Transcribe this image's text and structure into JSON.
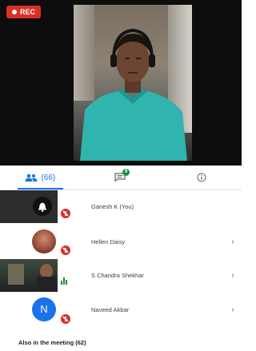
{
  "recording": {
    "label": "REC"
  },
  "tabs": [
    {
      "name": "people",
      "count": "(66)",
      "icon": "people-icon"
    },
    {
      "name": "chat",
      "badge": "9",
      "icon": "chat-icon"
    },
    {
      "name": "info",
      "icon": "info-icon"
    }
  ],
  "participants": [
    {
      "name": "Ganesh K (You)",
      "muted": true,
      "has_chevron": false,
      "avatar": "bell-tile"
    },
    {
      "name": "Hellen Daisy",
      "muted": true,
      "has_chevron": true,
      "avatar": "photo"
    },
    {
      "name": "S Chandra Shekhar",
      "muted": false,
      "speaking": true,
      "has_chevron": true,
      "avatar": "video"
    },
    {
      "name": "Naveed Akbar",
      "muted": true,
      "has_chevron": true,
      "avatar_letter": "N"
    }
  ],
  "footer": {
    "label": "Also in the meeting (62)"
  },
  "colors": {
    "accent": "#1a73e8",
    "rec": "#d93025",
    "speaking": "#1e8e3e"
  }
}
